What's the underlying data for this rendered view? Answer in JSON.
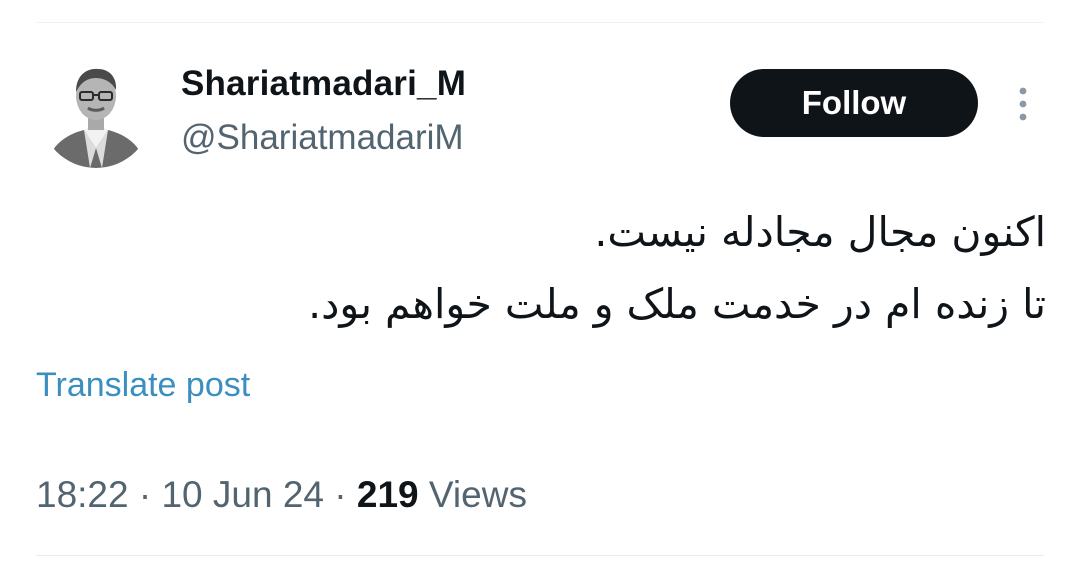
{
  "tweet": {
    "author": {
      "display_name": "Shariatmadari_M",
      "handle": "@ShariatmadariM",
      "avatar_icon": "profile-photo"
    },
    "follow_label": "Follow",
    "more_icon": "more-vertical-icon",
    "text_lines": [
      "اکنون مجال مجادله نیست.",
      "تا زنده ام در خدمت ملک و ملت خواهم بود."
    ],
    "translate_label": "Translate post",
    "meta": {
      "time": "18:22",
      "separator": "·",
      "date": "10 Jun 24",
      "views_count": "219",
      "views_label": "Views"
    }
  },
  "colors": {
    "text": "#0f1419",
    "secondary": "#536471",
    "link": "#3b8fbf",
    "button_bg": "#0f1419",
    "button_text": "#ffffff"
  }
}
